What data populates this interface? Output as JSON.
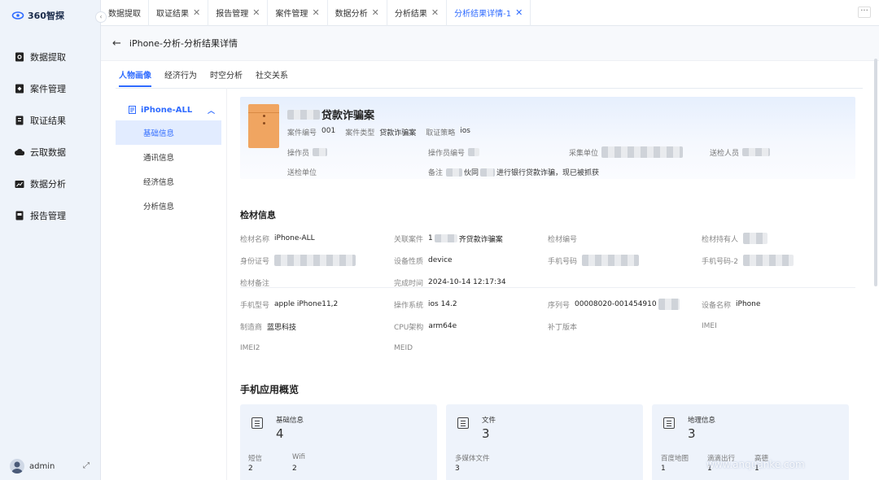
{
  "app": {
    "logo_text": "360智探"
  },
  "sidebar": {
    "items": [
      {
        "label": "数据提取",
        "icon": "data-extract-icon"
      },
      {
        "label": "案件管理",
        "icon": "case-icon"
      },
      {
        "label": "取证结果",
        "icon": "evidence-icon"
      },
      {
        "label": "云取数据",
        "icon": "cloud-icon"
      },
      {
        "label": "数据分析",
        "icon": "analysis-icon"
      },
      {
        "label": "报告管理",
        "icon": "report-icon"
      }
    ],
    "user": "admin"
  },
  "tabs": [
    {
      "label": "数据提取",
      "closable": false
    },
    {
      "label": "取证结果",
      "closable": true
    },
    {
      "label": "报告管理",
      "closable": true
    },
    {
      "label": "案件管理",
      "closable": true
    },
    {
      "label": "数据分析",
      "closable": true
    },
    {
      "label": "分析结果",
      "closable": true
    },
    {
      "label": "分析结果详情-1",
      "closable": true,
      "active": true
    }
  ],
  "page": {
    "title": "iPhone-分析-分析结果详情",
    "subtabs": [
      "人物画像",
      "经济行为",
      "时空分析",
      "社交关系"
    ]
  },
  "tree": {
    "root": "iPhone-ALL",
    "items": [
      "基础信息",
      "通讯信息",
      "经济信息",
      "分析信息"
    ]
  },
  "case": {
    "title_suffix": "贷款诈骗案",
    "meta": [
      {
        "k": "案件编号",
        "v": "001"
      },
      {
        "k": "案件类型",
        "v": "贷款诈骗案"
      },
      {
        "k": "取证策略",
        "v": "ios"
      }
    ],
    "row1": [
      "操作员",
      "操作员编号",
      "采集单位",
      "送检人员"
    ],
    "row2_k1": "送检单位",
    "row2_k2": "备注",
    "row2_v2a": "伙同",
    "row2_v2b": "进行银行贷款诈骗，现已被抓获"
  },
  "material": {
    "title": "检材信息",
    "name_k": "检材名称",
    "name_v": "iPhone-ALL",
    "case_k": "关联案件",
    "case_v_prefix": "1",
    "case_v_suffix": "齐贷款诈骗案",
    "no_k": "检材编号",
    "holder_k": "检材持有人",
    "id_k": "身份证号",
    "nature_k": "设备性质",
    "nature_v": "device",
    "phone_k": "手机号码",
    "phone2_k": "手机号码-2",
    "note_k": "检材备注",
    "done_k": "完成时间",
    "done_v": "2024-10-14 12:17:34"
  },
  "device": {
    "model_k": "手机型号",
    "model_v": "apple iPhone11,2",
    "os_k": "操作系统",
    "os_v": "ios 14.2",
    "serial_k": "序列号",
    "serial_v": "00008020-001454910",
    "dname_k": "设备名称",
    "dname_v": "iPhone",
    "maker_k": "制造商",
    "maker_v": "蓝思科技",
    "cpu_k": "CPU架构",
    "cpu_v": "arm64e",
    "patch_k": "补丁版本",
    "imei_k": "IMEI",
    "imei2_k": "IMEI2",
    "meid_k": "MEID"
  },
  "apps": {
    "title": "手机应用概览",
    "cards": [
      {
        "name": "基础信息",
        "count": "4",
        "subs": [
          {
            "k": "短信",
            "v": "2"
          },
          {
            "k": "Wifi",
            "v": "2"
          }
        ]
      },
      {
        "name": "文件",
        "count": "3",
        "subs": [
          {
            "k": "多媒体文件",
            "v": "3"
          }
        ]
      },
      {
        "name": "地理信息",
        "count": "3",
        "subs": [
          {
            "k": "百度地图",
            "v": "1"
          },
          {
            "k": "滴滴出行",
            "v": "1"
          },
          {
            "k": "高德",
            "v": "1"
          }
        ]
      }
    ]
  },
  "watermark": "www.anquanke.com",
  "colors": {
    "accent": "#2f6bff",
    "folder": "#f0a561"
  }
}
